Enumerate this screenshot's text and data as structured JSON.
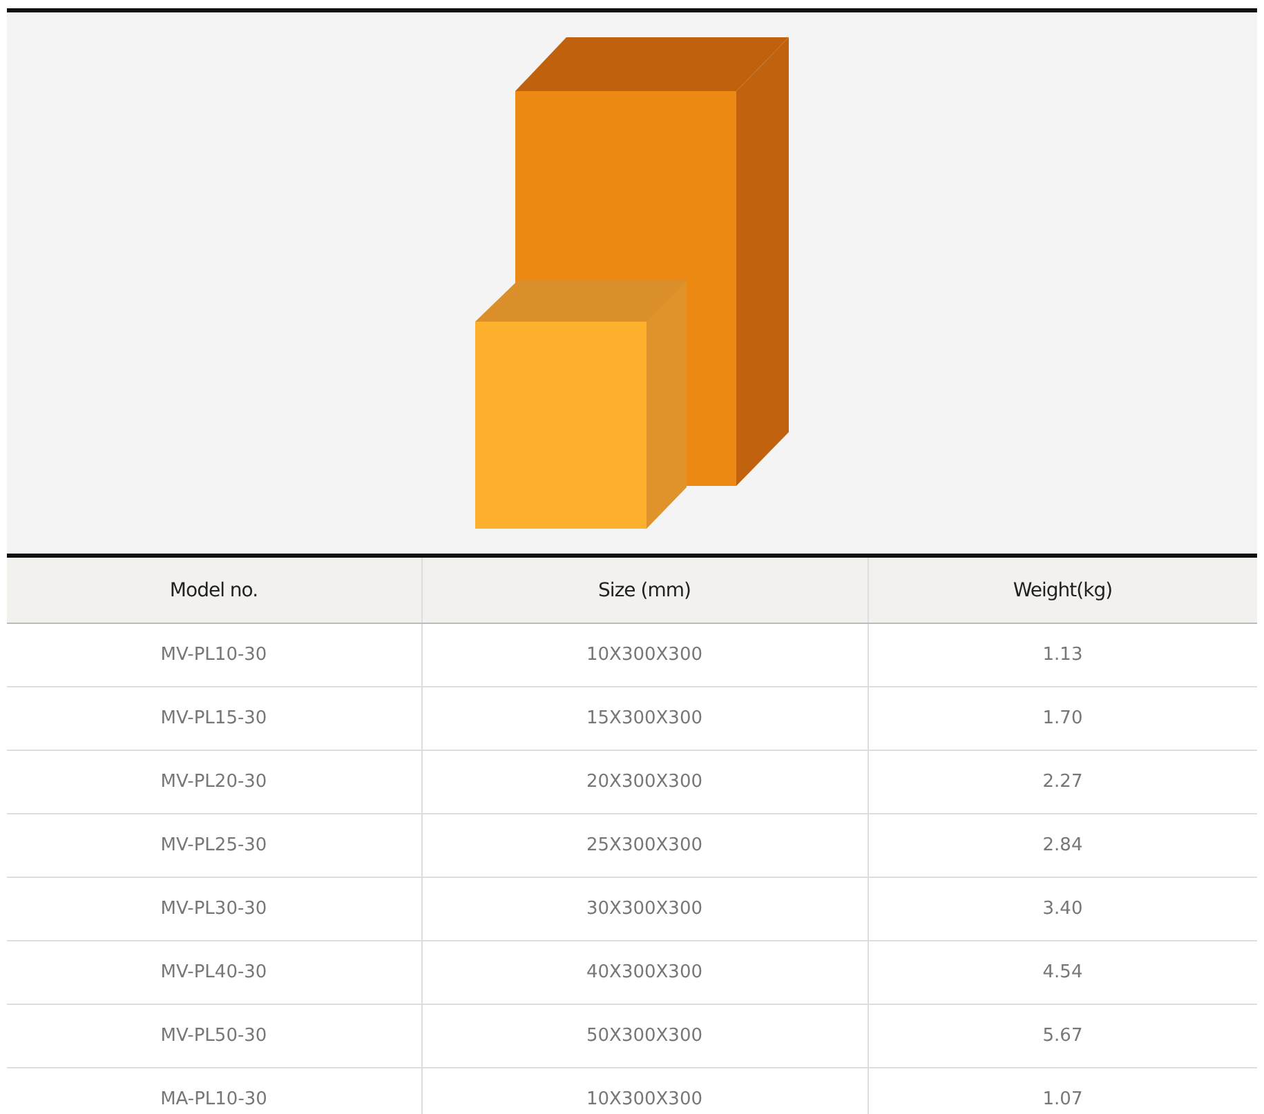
{
  "table": {
    "columns": [
      "Model no.",
      "Size (mm)",
      "Weight(kg)"
    ],
    "rows": [
      [
        "MV-PL10-30",
        "10X300X300",
        "1.13"
      ],
      [
        "MV-PL15-30",
        "15X300X300",
        "1.70"
      ],
      [
        "MV-PL20-30",
        "20X300X300",
        "2.27"
      ],
      [
        "MV-PL25-30",
        "25X300X300",
        "2.84"
      ],
      [
        "MV-PL30-30",
        "30X300X300",
        "3.40"
      ],
      [
        "MV-PL40-30",
        "40X300X300",
        "4.54"
      ],
      [
        "MV-PL50-30",
        "50X300X300",
        "5.67"
      ],
      [
        "MA-PL10-30",
        "10X300X300",
        "1.07"
      ]
    ]
  }
}
